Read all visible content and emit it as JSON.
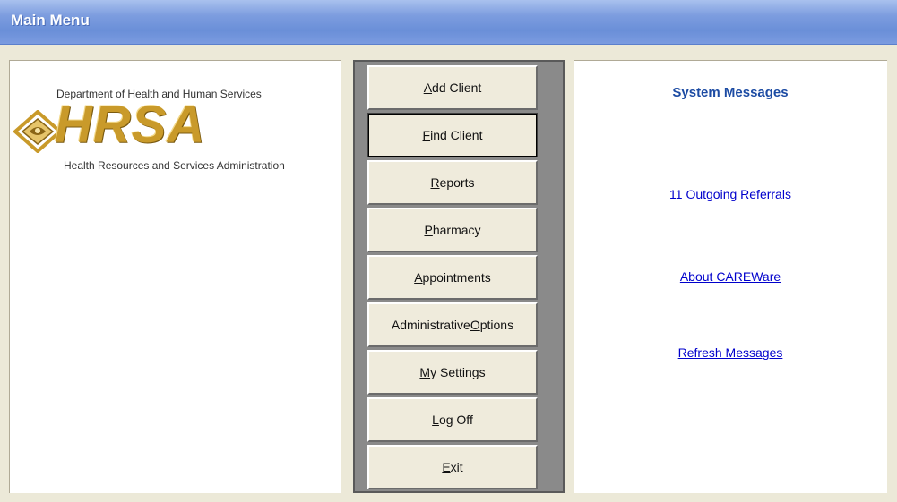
{
  "window": {
    "title": "Main Menu"
  },
  "logo": {
    "department": "Department of Health and Human Services",
    "wordmark": "HRSA",
    "administration": "Health Resources and Services Administration",
    "icon": "eagle-icon",
    "gold_color": "#c99a2a"
  },
  "menu": {
    "buttons": [
      {
        "pre": "",
        "mnemonic": "A",
        "post": "dd Client"
      },
      {
        "pre": "",
        "mnemonic": "F",
        "post": "ind Client"
      },
      {
        "pre": "",
        "mnemonic": "R",
        "post": "eports"
      },
      {
        "pre": "",
        "mnemonic": "P",
        "post": "harmacy"
      },
      {
        "pre": "",
        "mnemonic": "A",
        "post": "ppointments"
      },
      {
        "pre": "Administrative ",
        "mnemonic": "O",
        "post": "ptions"
      },
      {
        "pre": "",
        "mnemonic": "M",
        "post": "y Settings"
      },
      {
        "pre": "",
        "mnemonic": "L",
        "post": "og Off"
      },
      {
        "pre": "",
        "mnemonic": "E",
        "post": "xit"
      }
    ]
  },
  "messages": {
    "title": "System Messages",
    "outgoing_referrals": "11  Outgoing Referrals",
    "about": "About CAREWare",
    "refresh": "Refresh Messages"
  },
  "colors": {
    "title_text": "#1c4ba3",
    "link": "#0000cc"
  }
}
